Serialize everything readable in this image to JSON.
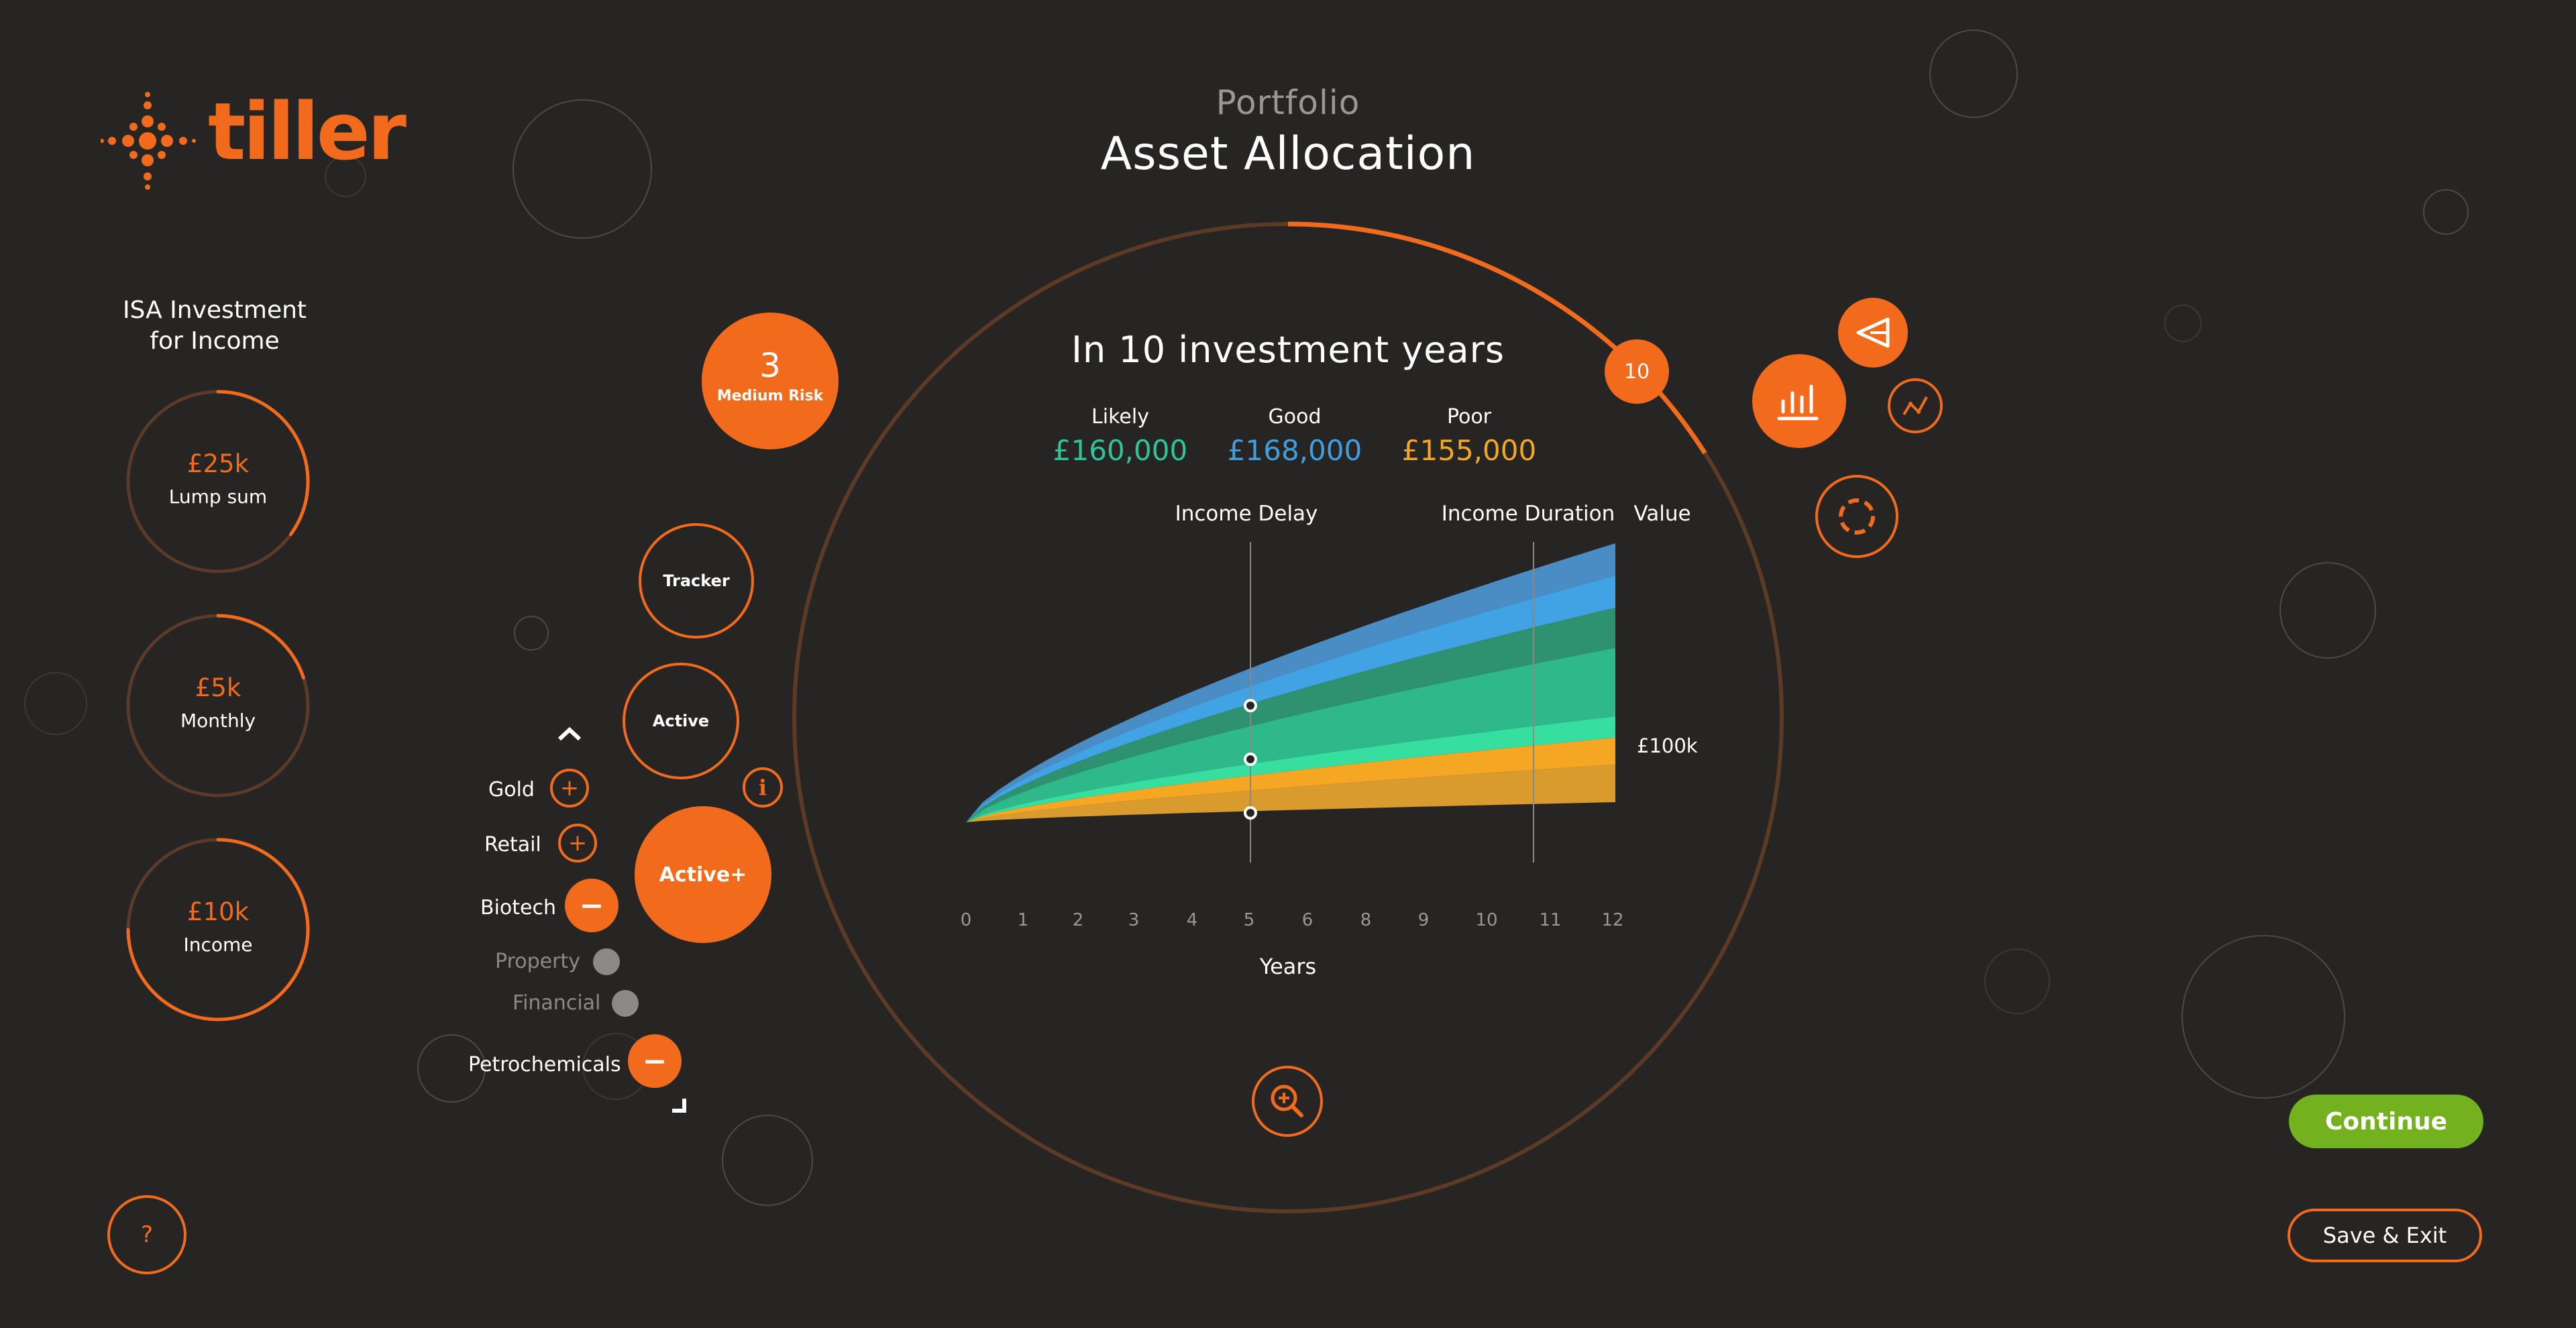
{
  "brand": {
    "name": "tiller",
    "accent": "#f26b1d",
    "background": "#272524"
  },
  "header": {
    "subtitle": "Portfolio",
    "title": "Asset Allocation"
  },
  "sidebar": {
    "title_line1": "ISA Investment",
    "title_line2": "for Income",
    "items": [
      {
        "value": "£25k",
        "label": "Lump sum",
        "fraction": 0.35
      },
      {
        "value": "£5k",
        "label": "Monthly",
        "fraction": 0.2
      },
      {
        "value": "£10k",
        "label": "Income",
        "fraction": 0.75
      }
    ],
    "help_label": "?"
  },
  "risk": {
    "level": "3",
    "label": "Medium Risk"
  },
  "strategies": {
    "tracker": "Tracker",
    "active": "Active",
    "active_plus": "Active+"
  },
  "sectors": [
    {
      "label": "Gold",
      "action": "+"
    },
    {
      "label": "Retail",
      "action": "+"
    },
    {
      "label": "Biotech",
      "action": "−"
    },
    {
      "label": "Property",
      "action": ""
    },
    {
      "label": "Financial",
      "action": ""
    },
    {
      "label": "Petrochemicals",
      "action": "−"
    }
  ],
  "info_icon": "i",
  "forecast": {
    "heading": "In 10 investment years",
    "years": "10",
    "years_fraction": 0.16,
    "outcomes": [
      {
        "label": "Likely",
        "value": "£160,000",
        "color": "#2ec59a"
      },
      {
        "label": "Good",
        "value": "£168,000",
        "color": "#3f9fe0"
      },
      {
        "label": "Poor",
        "value": "£155,000",
        "color": "#f5a623"
      }
    ]
  },
  "chart_data": {
    "type": "area",
    "x_ticks": [
      "0",
      "1",
      "2",
      "3",
      "4",
      "5",
      "6",
      "8",
      "9",
      "10",
      "11",
      "12"
    ],
    "xlabel": "Years",
    "ylabel": "Value",
    "y_annotation": "£100k",
    "markers": [
      "Income Delay",
      "Income Duration"
    ],
    "series_colors": [
      "#4a8cc4",
      "#41a3e4",
      "#2e9270",
      "#2fb98b",
      "#36dea0",
      "#f5a623",
      "#d99a2e"
    ]
  },
  "toolbar": {
    "continue_label": "Continue",
    "save_label": "Save & Exit"
  }
}
